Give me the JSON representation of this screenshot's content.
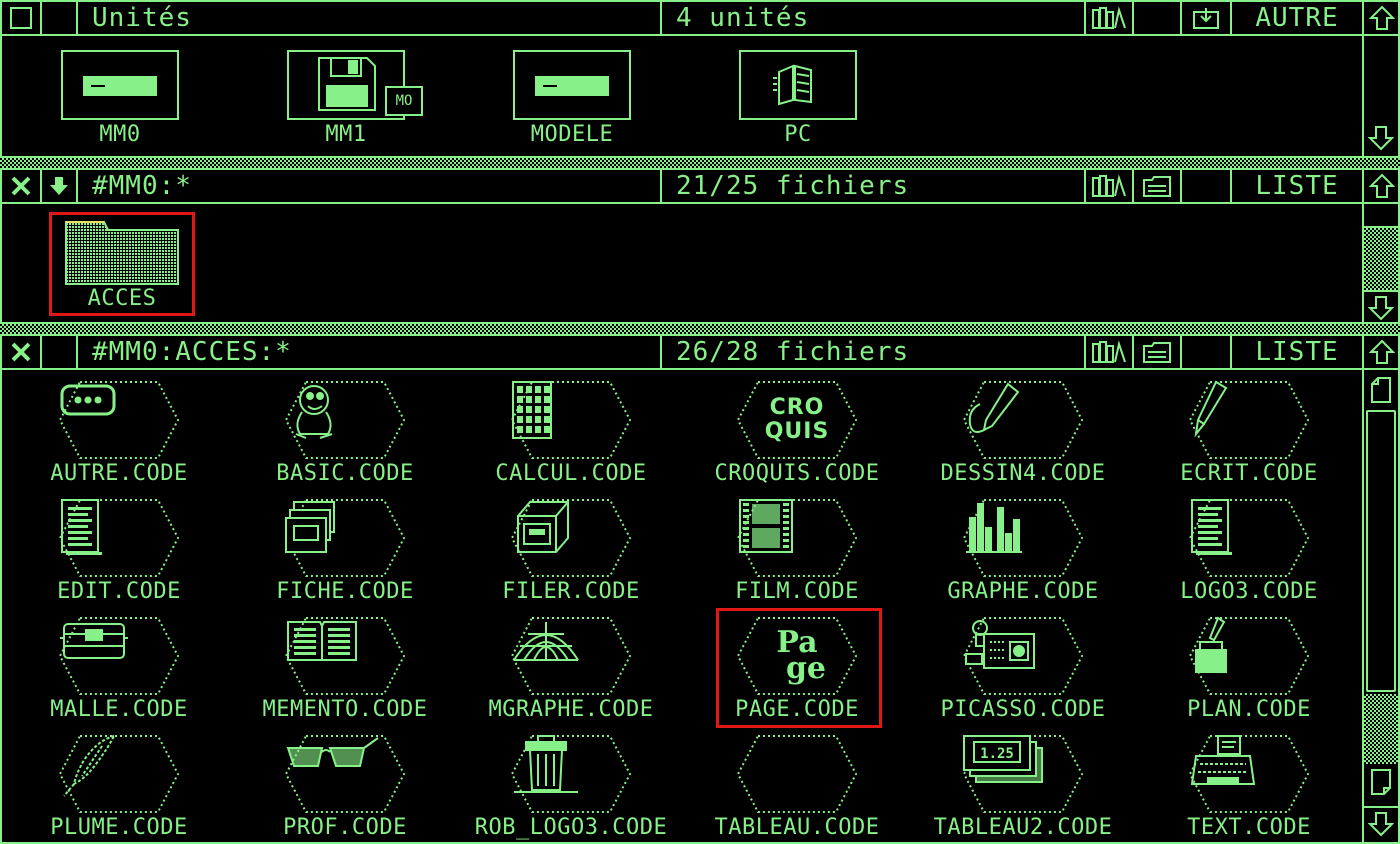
{
  "colors": {
    "fg": "#88f088",
    "bg": "#000000",
    "highlight": "#e01818"
  },
  "units_window": {
    "title": "Unités",
    "count": "4 unités",
    "mode": "AUTRE",
    "units": [
      {
        "name": "MM0",
        "icon": "drive-icon"
      },
      {
        "name": "MM1",
        "icon": "floppy-icon",
        "badge": "MO"
      },
      {
        "name": "MODELE",
        "icon": "drive-icon"
      },
      {
        "name": "PC",
        "icon": "pc-icon"
      }
    ]
  },
  "folder_window": {
    "path": "#MM0:*",
    "count": "21/25 fichiers",
    "mode": "LISTE",
    "items": [
      {
        "name": "ACCES",
        "icon": "folder-icon"
      }
    ]
  },
  "files_window": {
    "path": "#MM0:ACCES:*",
    "count": "26/28 fichiers",
    "mode": "LISTE",
    "items": [
      {
        "name": "AUTRE.CODE",
        "icon": "dots-icon"
      },
      {
        "name": "BASIC.CODE",
        "icon": "creature-icon"
      },
      {
        "name": "CALCUL.CODE",
        "icon": "calculator-icon"
      },
      {
        "name": "CROQUIS.CODE",
        "icon": "croquis-icon",
        "icon_text": "CRO\nQUIS"
      },
      {
        "name": "DESSIN4.CODE",
        "icon": "pen-icon"
      },
      {
        "name": "ECRIT.CODE",
        "icon": "nib-icon"
      },
      {
        "name": "EDIT.CODE",
        "icon": "document-icon"
      },
      {
        "name": "FICHE.CODE",
        "icon": "cardfile-icon"
      },
      {
        "name": "FILER.CODE",
        "icon": "cabinet-icon"
      },
      {
        "name": "FILM.CODE",
        "icon": "film-icon"
      },
      {
        "name": "GRAPHE.CODE",
        "icon": "barchart-icon"
      },
      {
        "name": "LOGO3.CODE",
        "icon": "document-icon"
      },
      {
        "name": "MALLE.CODE",
        "icon": "trunk-icon"
      },
      {
        "name": "MEMENTO.CODE",
        "icon": "book-icon"
      },
      {
        "name": "MGRAPHE.CODE",
        "icon": "mesh-icon"
      },
      {
        "name": "PAGE.CODE",
        "icon": "page-icon",
        "icon_text": "Pa\nge"
      },
      {
        "name": "PICASSO.CODE",
        "icon": "camera-icon"
      },
      {
        "name": "PLAN.CODE",
        "icon": "inkpot-icon"
      },
      {
        "name": "PLUME.CODE",
        "icon": "feather-icon"
      },
      {
        "name": "PROF.CODE",
        "icon": "glasses-icon"
      },
      {
        "name": "ROB_LOGO3.CODE",
        "icon": "trash-icon"
      },
      {
        "name": "TABLEAU.CODE",
        "icon": "blank-icon"
      },
      {
        "name": "TABLEAU2.CODE",
        "icon": "money-icon",
        "icon_text": "1.25"
      },
      {
        "name": "TEXT.CODE",
        "icon": "typewriter-icon"
      }
    ]
  }
}
